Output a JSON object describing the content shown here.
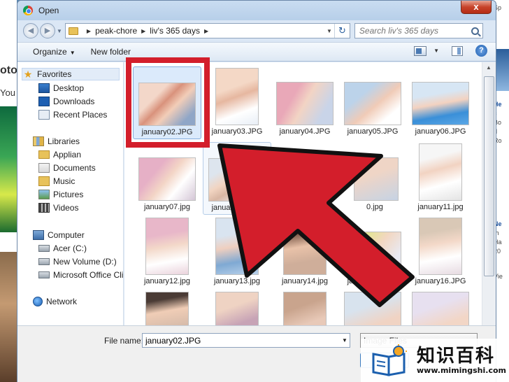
{
  "window": {
    "title": "Open",
    "close_glyph": "x"
  },
  "address": {
    "crumbs": [
      "peak-chore",
      "liv's 365 days"
    ],
    "search_placeholder": "Search liv's 365 days"
  },
  "toolbar": {
    "organize_label": "Organize",
    "new_folder_label": "New folder"
  },
  "nav": {
    "favorites": "Favorites",
    "desktop": "Desktop",
    "downloads": "Downloads",
    "recent_places": "Recent Places",
    "libraries": "Libraries",
    "applian": "Applian",
    "documents": "Documents",
    "music": "Music",
    "pictures": "Pictures",
    "videos": "Videos",
    "computer": "Computer",
    "drive_c": "Acer (C:)",
    "drive_d": "New Volume (D:)",
    "drive_office": "Microsoft Office Clic",
    "network": "Network"
  },
  "files": [
    "january02.JPG",
    "january03.JPG",
    "january04.JPG",
    "january05.JPG",
    "january06.JPG",
    "january07.jpg",
    "january08.JPG",
    "0.jpg",
    "january11.jpg",
    "january12.jpg",
    "january13.jpg",
    "january14.jpg",
    "january15.JPG",
    "january16.JPG"
  ],
  "bottom": {
    "file_name_label": "File name:",
    "file_name_value": "january02.JPG",
    "file_type_value": "Image Files"
  },
  "background_page": {
    "left_text_1": "oto",
    "left_text_2": "You",
    "right_text": [
      "Sp",
      "He",
      "c",
      "Bo",
      "d",
      "Ro",
      "Ne",
      "th",
      "Ha",
      "20",
      "Vie"
    ]
  },
  "watermark": {
    "brand": "知识百科",
    "url": "www.mimingshi.com"
  },
  "colors": {
    "highlight": "#d31e2b",
    "selection": "#dbeafb"
  }
}
